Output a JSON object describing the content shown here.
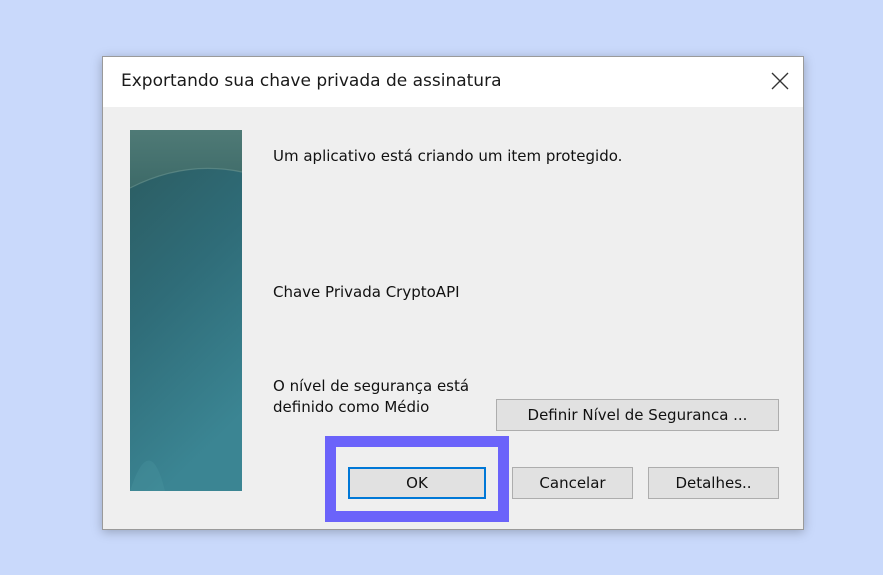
{
  "dialog": {
    "title": "Exportando sua chave privada de assinatura",
    "message": "Um aplicativo está criando um item protegido.",
    "item_name": "Chave Privada CryptoAPI",
    "security_line1": "O nível de segurança está",
    "security_line2": "definido como Médio",
    "set_level_label": "Definir Nível de Seguranca ...",
    "ok_label": "OK",
    "cancel_label": "Cancelar",
    "details_label": "Detalhes.."
  },
  "colors": {
    "background": "#c9d9fb",
    "highlight": "#6b63fa",
    "default_button_border": "#0078d7"
  }
}
